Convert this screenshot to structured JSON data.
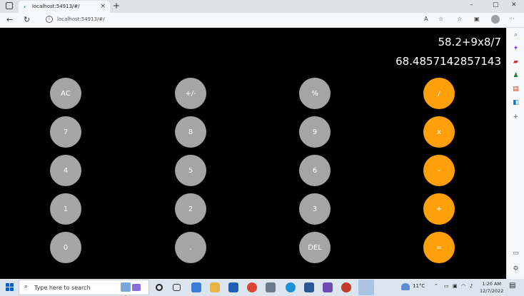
{
  "browser": {
    "tab_title": "localhost:54913/#/",
    "tab_close": "×",
    "new_tab": "+",
    "url": "localhost:54913/#/",
    "back": "←",
    "reload": "↻",
    "minimize": "–",
    "maximize": "▢",
    "close": "✕",
    "menu": "···"
  },
  "calculator": {
    "expression": "58.2+9x8/7",
    "result": "68.4857142857143",
    "keys": [
      {
        "label": "AC",
        "type": "func"
      },
      {
        "label": "+/-",
        "type": "func"
      },
      {
        "label": "%",
        "type": "func"
      },
      {
        "label": "/",
        "type": "op"
      },
      {
        "label": "7",
        "type": "num"
      },
      {
        "label": "8",
        "type": "num"
      },
      {
        "label": "9",
        "type": "num"
      },
      {
        "label": "x",
        "type": "op"
      },
      {
        "label": "4",
        "type": "num"
      },
      {
        "label": "5",
        "type": "num"
      },
      {
        "label": "6",
        "type": "num"
      },
      {
        "label": "-",
        "type": "op"
      },
      {
        "label": "1",
        "type": "num"
      },
      {
        "label": "2",
        "type": "num"
      },
      {
        "label": "3",
        "type": "num"
      },
      {
        "label": "+",
        "type": "op"
      },
      {
        "label": "0",
        "type": "num"
      },
      {
        "label": ".",
        "type": "num"
      },
      {
        "label": "DEL",
        "type": "func"
      },
      {
        "label": "=",
        "type": "op"
      }
    ],
    "colors": {
      "gray": "#a5a5a5",
      "orange": "#ff9f0a",
      "background": "#000000"
    }
  },
  "taskbar": {
    "search_placeholder": "Type here to search",
    "temperature": "11°C",
    "time": "1:20 AM",
    "date": "12/7/2022"
  }
}
